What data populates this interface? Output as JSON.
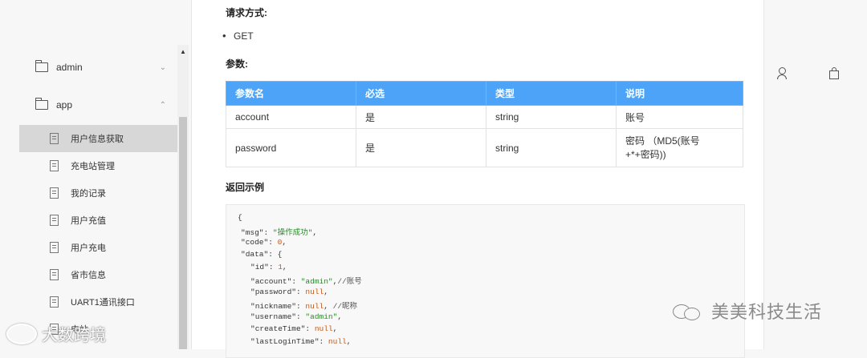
{
  "sidebar": {
    "folders": [
      {
        "label": "admin",
        "chevron": "chevron-down"
      },
      {
        "label": "app",
        "chevron": "chevron-up"
      }
    ],
    "items": [
      {
        "label": "用户信息获取",
        "active": true
      },
      {
        "label": "充电站管理"
      },
      {
        "label": "我的记录"
      },
      {
        "label": "用户充值"
      },
      {
        "label": "用户充电"
      },
      {
        "label": "省市信息"
      },
      {
        "label": "UART1通讯接口"
      },
      {
        "label": "电站"
      }
    ]
  },
  "content": {
    "request_method_heading": "请求方式:",
    "request_method": "GET",
    "params_heading": "参数:",
    "table": {
      "headers": [
        "参数名",
        "必选",
        "类型",
        "说明"
      ],
      "rows": [
        [
          "account",
          "是",
          "string",
          "账号"
        ],
        [
          "password",
          "是",
          "string",
          "密码 （MD5(账号",
          "+*+密码))"
        ]
      ]
    },
    "response_heading": "返回示例",
    "code": {
      "l1": "{",
      "l2_key": "\"msg\"",
      "l2_val": "\"操作成功\"",
      "l3_key": "\"code\"",
      "l3_val": "0",
      "l4": "\"data\": {",
      "l5_key": "\"id\"",
      "l5_val": "1",
      "l6_key": "\"account\"",
      "l6_val": "\"admin\"",
      "l6_cm": "//账号",
      "l7_key": "\"password\"",
      "l7_val": "null",
      "l8_key": "\"nickname\"",
      "l8_val": "null",
      "l8_cm": "//昵称",
      "l9_key": "\"username\"",
      "l9_val": "\"admin\"",
      "l10_key": "\"createTime\"",
      "l10_val": "null",
      "l11_key": "\"lastLoginTime\"",
      "l11_val": "null"
    }
  },
  "header_icons": [
    "user-icon",
    "shopping-bag-icon"
  ],
  "watermark_right": "美美科技生活",
  "watermark_left": "大数跨境"
}
